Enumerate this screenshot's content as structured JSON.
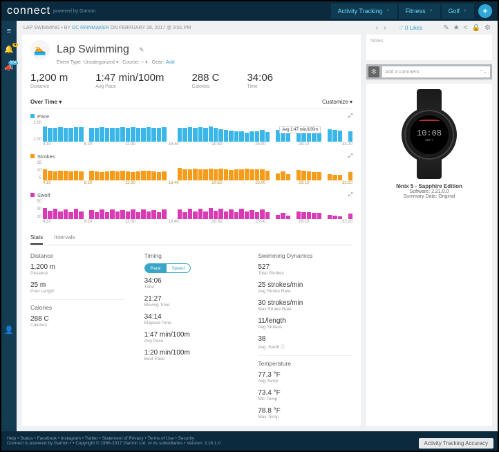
{
  "brand": {
    "name": "connect",
    "sub": "powered by Garmin"
  },
  "topTabs": [
    "Activity Tracking",
    "Fitness",
    "Golf"
  ],
  "breadcrumb": {
    "section": "LAP SWIMMING",
    "by": "BY",
    "author": "DC RAINMAKER",
    "on": "ON FEBRUARY 28, 2017 @ 3:51 PM"
  },
  "likes": "0 Likes",
  "title": "Lap Swimming",
  "subline": {
    "eventType": "Event Type: Uncategorized ▾",
    "course": "Course: -- ▾",
    "gear": "Gear:",
    "addGear": "Add"
  },
  "topMetrics": [
    {
      "v": "1,200 m",
      "l": "Distance"
    },
    {
      "v": "1:47 min/100m",
      "l": "Avg Pace"
    },
    {
      "v": "288 C",
      "l": "Calories"
    },
    {
      "v": "34:06",
      "l": "Time"
    }
  ],
  "chartHeader": {
    "left": "Over Time ▾",
    "right": "Customize ▾"
  },
  "avgFlag": "Avg  1:47 min/100m",
  "xticks": [
    "4:10",
    "8:20",
    "12:30",
    "16:40",
    "20:50",
    "25:00",
    "29:10",
    "33:20"
  ],
  "chart_data": [
    {
      "type": "bar",
      "title": "Pace",
      "ylim": [
        1,
        2
      ],
      "yticks": [
        "1.00",
        "2.00"
      ],
      "color": "#3ab7e8",
      "values": [
        78,
        72,
        70,
        75,
        73,
        71,
        76,
        74,
        0,
        70,
        72,
        74,
        71,
        73,
        70,
        75,
        72,
        74,
        71,
        73,
        76,
        70,
        72,
        74,
        0,
        0,
        73,
        70,
        75,
        72,
        74,
        71,
        78,
        70,
        65,
        60,
        58,
        55,
        52,
        48,
        52,
        55,
        60,
        50,
        0,
        62,
        55,
        45,
        0,
        60,
        58,
        55,
        50,
        48,
        0,
        64,
        60,
        56,
        0,
        52
      ]
    },
    {
      "type": "bar",
      "title": "Strokes",
      "ylim": [
        5,
        15
      ],
      "yticks": [
        "5",
        "10",
        "15"
      ],
      "color": "#f59c1a",
      "values": [
        60,
        55,
        50,
        52,
        54,
        50,
        53,
        50,
        0,
        55,
        50,
        48,
        50,
        52,
        50,
        53,
        50,
        48,
        50,
        55,
        52,
        50,
        48,
        50,
        0,
        0,
        68,
        60,
        62,
        65,
        63,
        60,
        65,
        62,
        65,
        60,
        58,
        60,
        62,
        65,
        63,
        60,
        62,
        55,
        0,
        40,
        50,
        35,
        0,
        56,
        52,
        50,
        48,
        45,
        0,
        36,
        32,
        30,
        0,
        48
      ]
    },
    {
      "type": "bar",
      "title": "Swolf",
      "ylim": [
        10,
        50
      ],
      "yticks": [
        "10",
        "30",
        "50"
      ],
      "color": "#d83bb3",
      "values": [
        60,
        45,
        58,
        42,
        55,
        40,
        56,
        44,
        0,
        50,
        38,
        52,
        40,
        54,
        42,
        50,
        44,
        52,
        40,
        54,
        42,
        50,
        38,
        52,
        0,
        0,
        55,
        40,
        58,
        44,
        56,
        42,
        60,
        45,
        58,
        42,
        55,
        40,
        56,
        44,
        50,
        38,
        52,
        40,
        0,
        25,
        35,
        20,
        0,
        44,
        40,
        38,
        36,
        34,
        0,
        22,
        18,
        16,
        0,
        30
      ]
    }
  ],
  "tabs2": [
    "Stats",
    "Intervals"
  ],
  "statsCols": {
    "distance": {
      "head": "Distance",
      "items": [
        {
          "v": "1,200 m",
          "l": "Distance"
        },
        {
          "v": "25 m",
          "l": "Pool Length"
        }
      ]
    },
    "calories": {
      "head": "Calories",
      "items": [
        {
          "v": "288 C",
          "l": "Calories"
        }
      ]
    },
    "timing": {
      "head": "Timing",
      "toggle": {
        "on": "Pace",
        "off": "Speed"
      },
      "items": [
        {
          "v": "34:06",
          "l": "Time"
        },
        {
          "v": "21:27",
          "l": "Moving Time"
        },
        {
          "v": "34:14",
          "l": "Elapsed Time"
        },
        {
          "v": "1:47 min/100m",
          "l": "Avg Pace"
        },
        {
          "v": "1:20 min/100m",
          "l": "Best Pace"
        }
      ]
    },
    "dynamics": {
      "head": "Swimming Dynamics",
      "items": [
        {
          "v": "527",
          "l": "Total Strokes"
        },
        {
          "v": "25 strokes/min",
          "l": "Avg Stroke Rate"
        },
        {
          "v": "30 strokes/min",
          "l": "Max Stroke Rate"
        },
        {
          "v": "11/length",
          "l": "Avg Strokes"
        },
        {
          "v": "38",
          "l": "Avg. Swolf ⓘ"
        }
      ]
    },
    "temperature": {
      "head": "Temperature",
      "items": [
        {
          "v": "77.3 °F",
          "l": "Avg Temp"
        },
        {
          "v": "73.4 °F",
          "l": "Min Temp"
        },
        {
          "v": "78.8 °F",
          "l": "Max Temp"
        }
      ]
    }
  },
  "notes": {
    "header": "Notes",
    "placeholder": "Add a comment."
  },
  "device": {
    "name": "fēnix 5 - Sapphire Edition",
    "sw": "Software: 2.21.0.0",
    "summary": "Summary Data: Original",
    "faceTime": "10:08",
    "faceDate": "SEP 7"
  },
  "footer": {
    "line1": "Help  •  Status  •  Facebook  •  Instagram  •  Twitter  •  Statement of Privacy  •  Terms of Use  •  Security",
    "line2": "Connect is powered by Garmin  •  • Copyright © 1996-2017 Garmin Ltd. or its subsidiaries  •  Version: 3.16.1.0",
    "accBtn": "Activity Tracking Accuracy"
  }
}
